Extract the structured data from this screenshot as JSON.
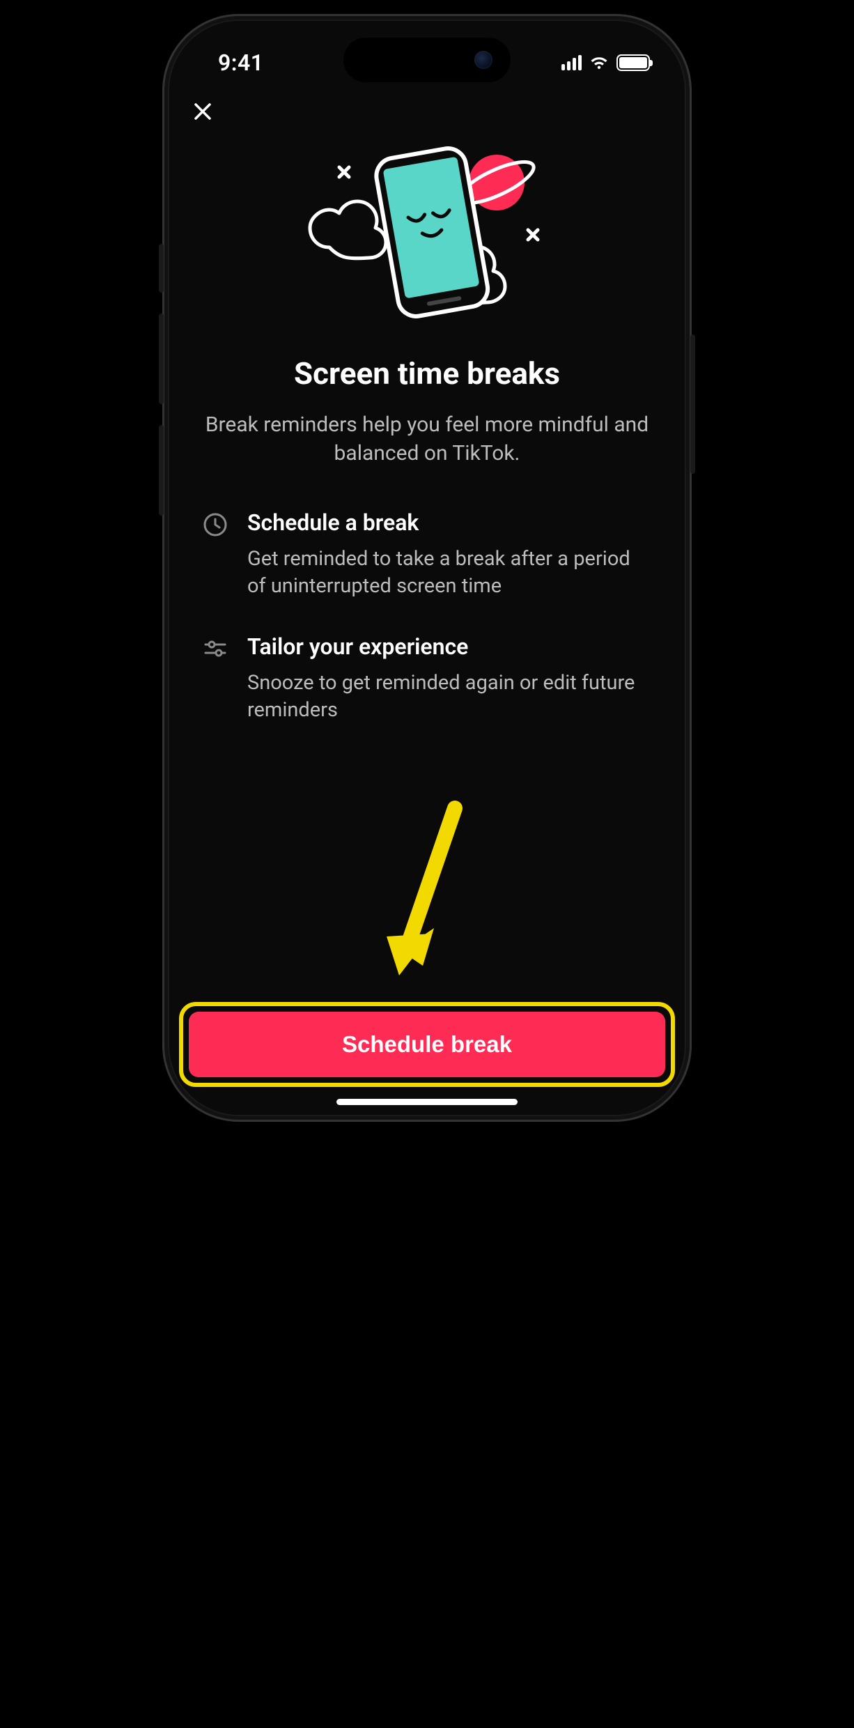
{
  "status": {
    "time": "9:41"
  },
  "close_label": "Close",
  "title": "Screen time breaks",
  "subtitle": "Break reminders help you feel more mindful and balanced on TikTok.",
  "features": [
    {
      "title": "Schedule a break",
      "desc": "Get reminded to take a break after a period of uninterrupted screen time"
    },
    {
      "title": "Tailor your experience",
      "desc": "Snooze to get reminded again or edit future reminders"
    }
  ],
  "cta_label": "Schedule break"
}
